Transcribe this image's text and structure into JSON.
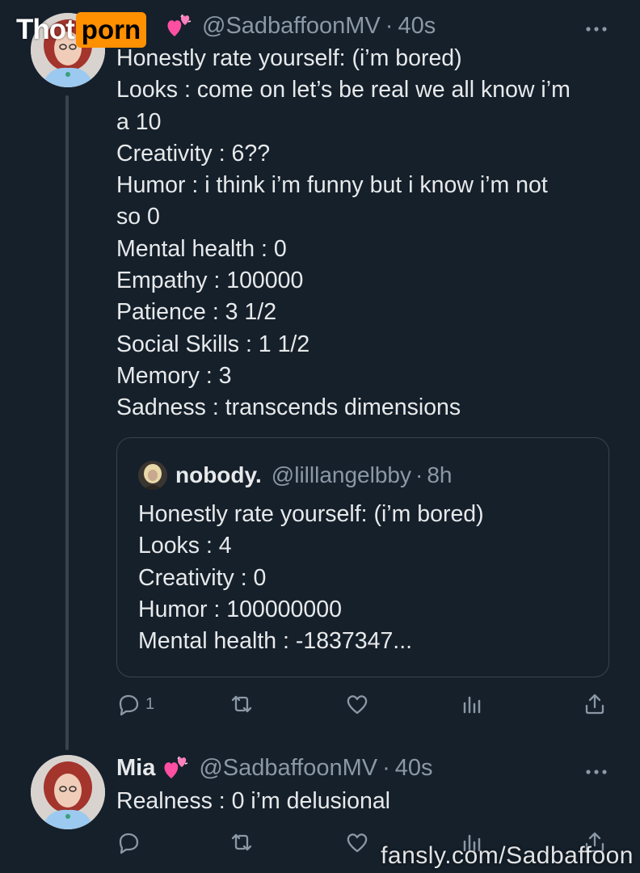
{
  "watermark": {
    "part_a": "Thot",
    "part_b": "porn"
  },
  "tweet1": {
    "handle": "@SadbaffoonMV",
    "dot": "·",
    "time": "40s",
    "more_icon": "more-dots-icon",
    "lines": [
      "Honestly rate yourself: (i’m bored)",
      "Looks : come on let’s be real we all know i’m",
      "a 10",
      "Creativity : 6??",
      "Humor : i think i’m funny but i know i’m not",
      "so 0",
      "Mental health : 0",
      "Empathy : 100000",
      "Patience : 3 1/2",
      "Social Skills : 1 1/2",
      "Memory : 3",
      "Sadness : transcends dimensions"
    ],
    "quote": {
      "name": "nobody.",
      "handle": "@lilllangelbby",
      "dot": "·",
      "time": "8h",
      "lines": [
        "Honestly rate yourself: (i’m bored)",
        "Looks : 4",
        "Creativity : 0",
        "Humor : 100000000",
        "Mental health : -1837347..."
      ]
    },
    "actions": {
      "reply_icon": "reply-icon",
      "reply_count": "1",
      "retweet_icon": "retweet-icon",
      "like_icon": "heart-icon",
      "views_icon": "views-icon",
      "share_icon": "share-icon"
    }
  },
  "tweet2": {
    "name": "Mia",
    "handle": "@SadbaffoonMV",
    "dot": "·",
    "time": "40s",
    "text": "Realness : 0 i’m delusional"
  },
  "footer_watermark": "fansly.com/Sadbaffoon",
  "colors": {
    "background": "#15202b",
    "text": "#e7e9ea",
    "muted": "#8b98a5",
    "border": "#38444d",
    "brand_orange": "#ff9000",
    "heart_pink": "#ff4fa3"
  }
}
